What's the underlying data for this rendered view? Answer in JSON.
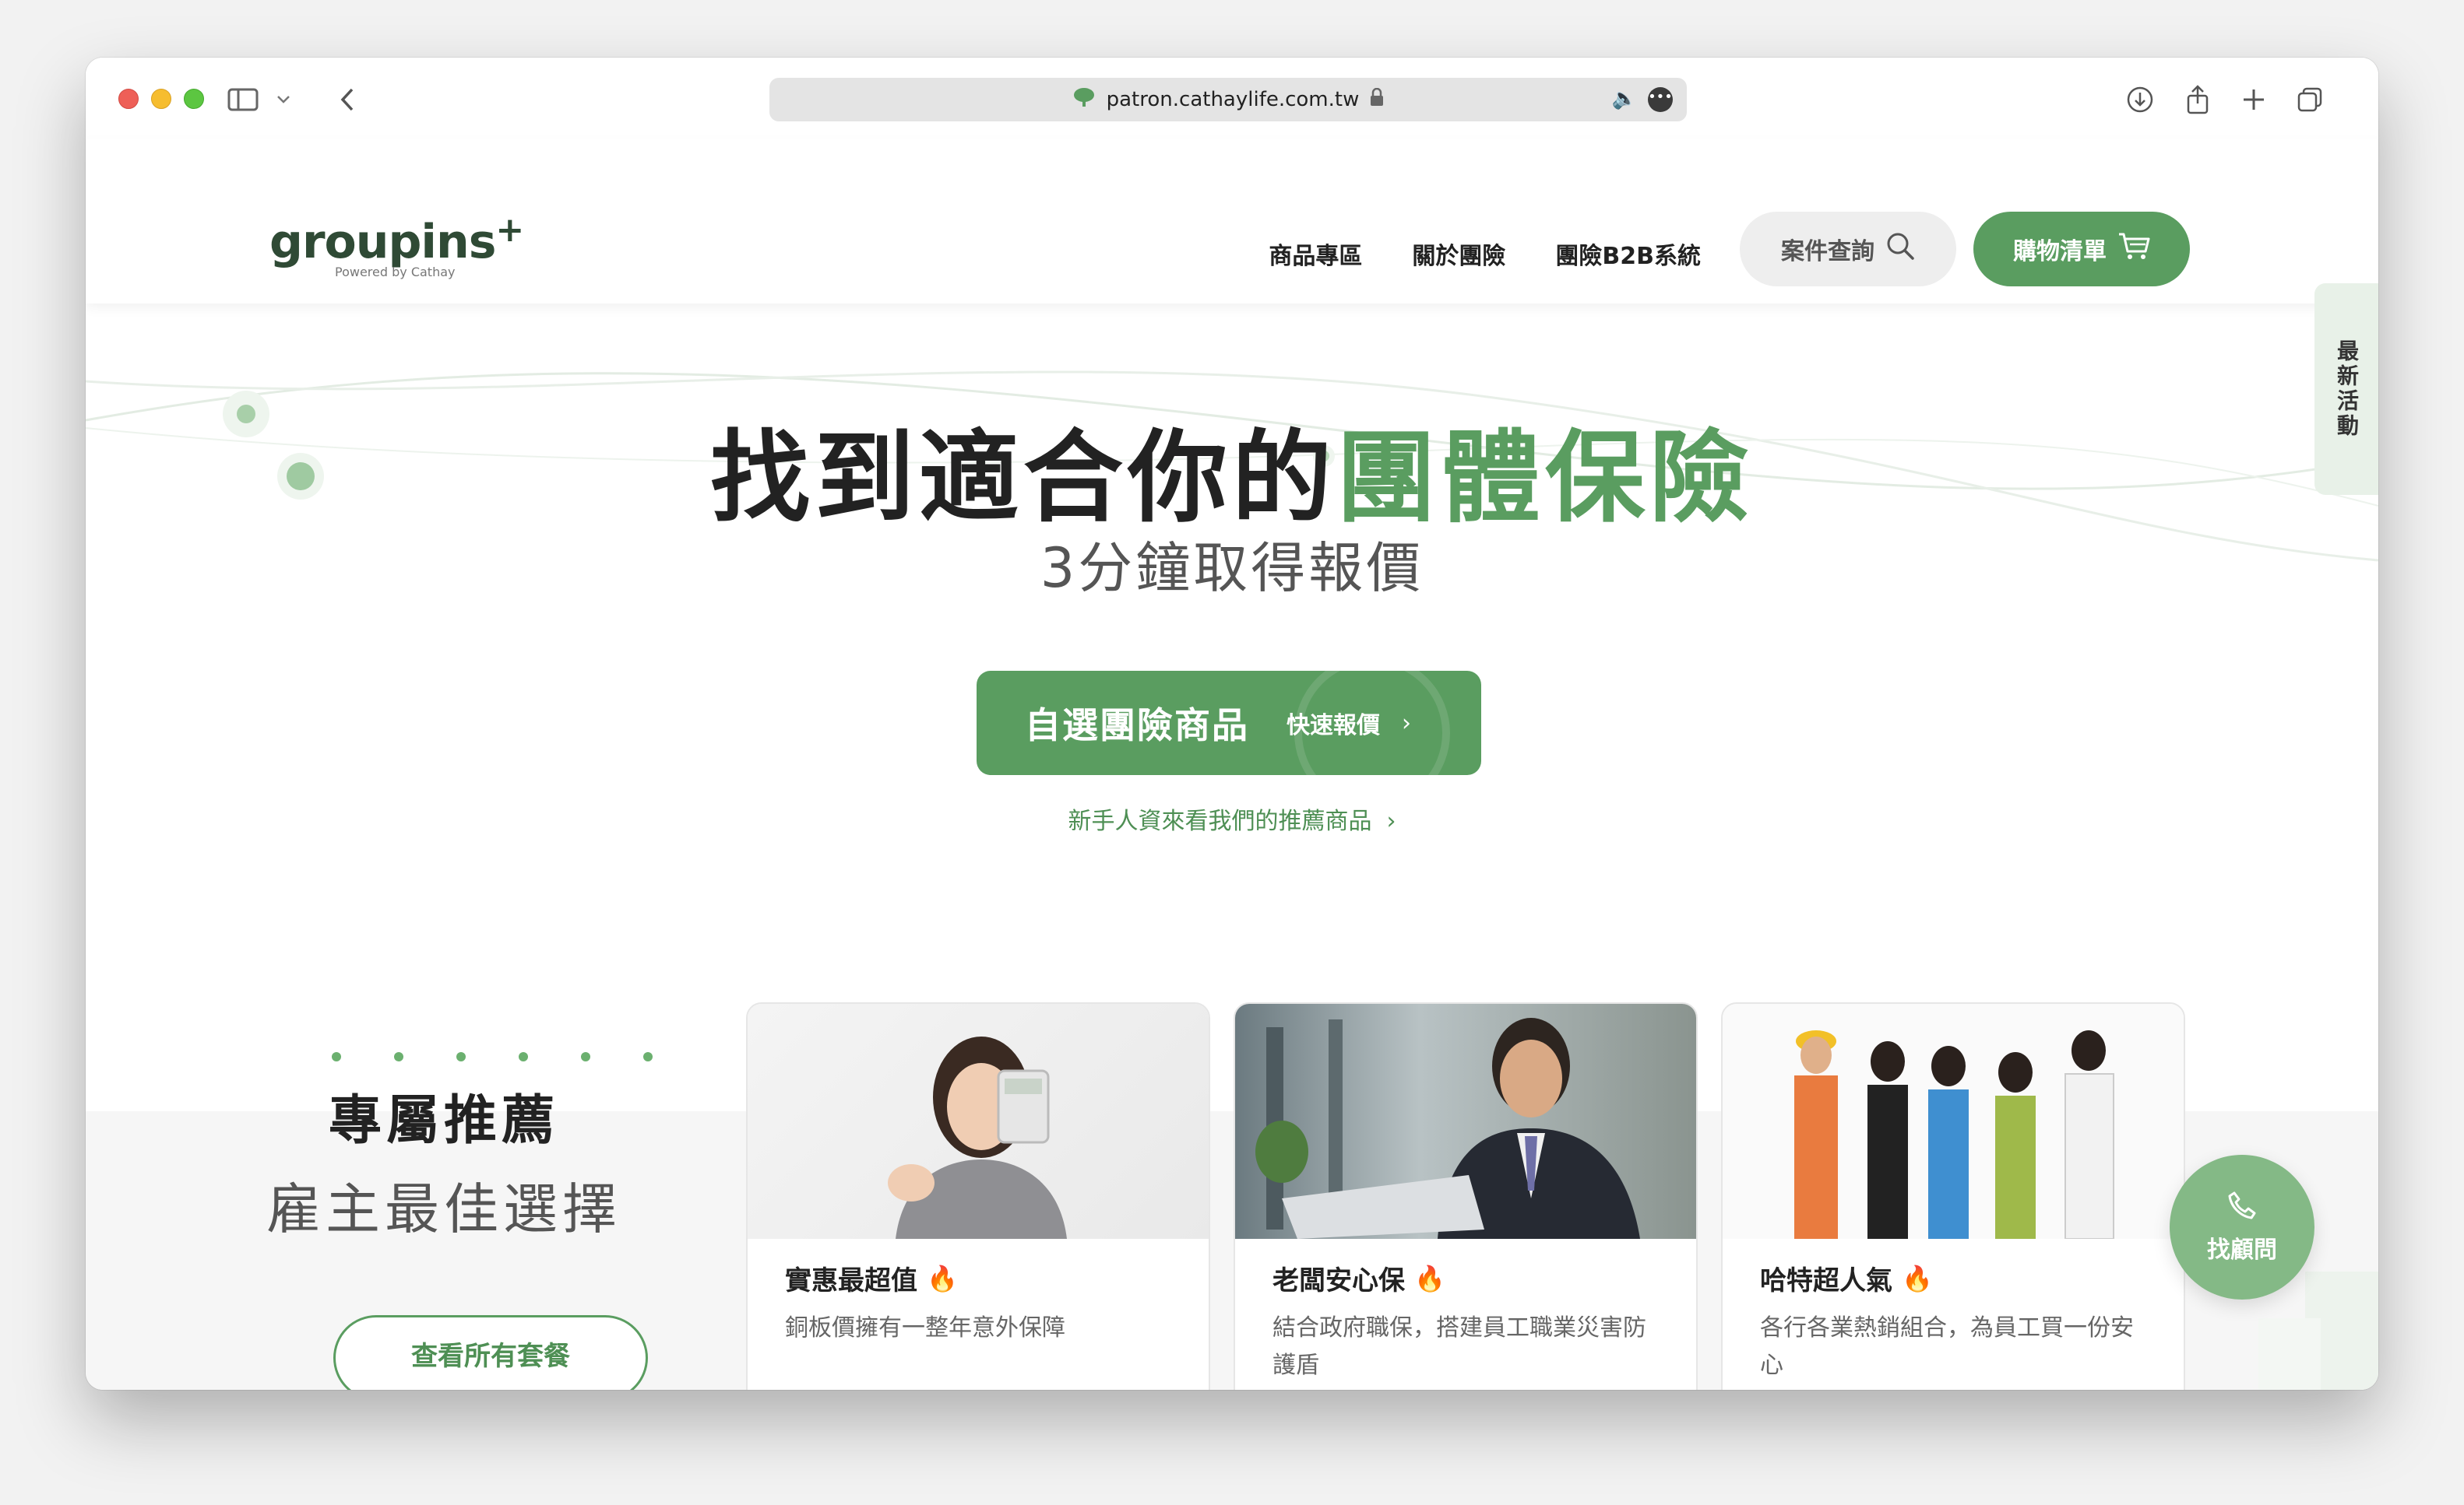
{
  "browser": {
    "url": "patron.cathaylife.com.tw",
    "icons": [
      "sidebar-icon",
      "chevron-down-icon",
      "back-icon",
      "download-icon",
      "share-icon",
      "new-tab-icon",
      "tabs-overview-icon"
    ]
  },
  "header": {
    "logo_main": "groupins",
    "logo_plus": "+",
    "logo_sub": "Powered by Cathay",
    "nav": [
      {
        "label": "商品專區"
      },
      {
        "label": "關於團險"
      },
      {
        "label": "團險B2B系統"
      }
    ],
    "search_label": "案件查詢",
    "cart_label": "購物清單"
  },
  "hero": {
    "title_main": "找到適合你的",
    "title_accent": "團體保險",
    "subtitle": "3分鐘取得報價",
    "cta_main": "自選團險商品",
    "cta_sub": "快速報價",
    "hint_link": "新手人資來看我們的推薦商品"
  },
  "side_tab": {
    "label": "最新活動"
  },
  "recommend": {
    "title": "專屬推薦",
    "subtitle": "雇主最佳選擇",
    "view_all": "查看所有套餐",
    "cards": [
      {
        "title": "實惠最超值",
        "desc": "銅板價擁有一整年意外保障"
      },
      {
        "title": "老闆安心保",
        "desc": "結合政府職保，搭建員工職業災害防護盾"
      },
      {
        "title": "哈特超人氣",
        "desc": "各行各業熱銷組合，為員工買一份安心"
      }
    ]
  },
  "fab": {
    "label": "找顧問"
  },
  "colors": {
    "brand_green": "#5a9d60",
    "light_green": "#84b986",
    "text_dark": "#222222"
  }
}
